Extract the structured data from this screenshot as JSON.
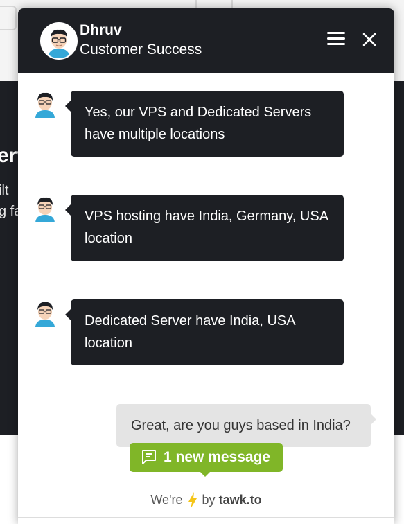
{
  "background": {
    "heading_fragment": "erv",
    "line1_fragment": "ilt",
    "line2_fragment": "g fa"
  },
  "header": {
    "agent_name": "Dhruv",
    "agent_role": "Customer Success",
    "menu_icon": "hamburger-icon",
    "close_icon": "close-icon"
  },
  "messages": [
    {
      "sender": "agent",
      "text": "Yes, our VPS and Dedicated Servers have multiple locations"
    },
    {
      "sender": "agent",
      "text": "VPS hosting have India, Germany, USA location"
    },
    {
      "sender": "agent",
      "text": "Dedicated Server have India, USA location"
    },
    {
      "sender": "visitor",
      "text": "Great, are you guys based in India?"
    }
  ],
  "new_message_badge": {
    "label": "1 new message",
    "icon": "chat-icon",
    "color": "#80b628"
  },
  "branding": {
    "prefix": "We're",
    "icon": "lightning-icon",
    "by": "by",
    "brand": "tawk.to"
  },
  "colors": {
    "dark": "#1d1f24",
    "accent": "#80b628",
    "visitor_bubble": "#e4e4e4"
  }
}
